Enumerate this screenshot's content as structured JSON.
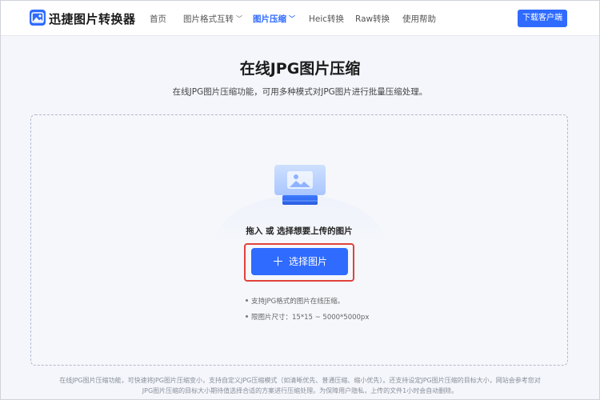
{
  "header": {
    "brand": "迅捷图片转换器",
    "nav": [
      {
        "label": "首页"
      },
      {
        "label": "图片格式互转"
      },
      {
        "label": "图片压缩"
      },
      {
        "label": "Heic转换"
      },
      {
        "label": "Raw转换"
      },
      {
        "label": "使用帮助"
      }
    ],
    "download_label": "下载客户端",
    "accent_color": "#2f6bff"
  },
  "main": {
    "title": "在线JPG图片压缩",
    "subtitle": "在线JPG图片压缩功能，可用多种模式对JPG图片进行批量压缩处理。",
    "upload": {
      "drop_text": "拖入 或 选择想要上传的图片",
      "select_label": "选择图片",
      "tips": [
        "支持JPG格式的图片在线压缩。",
        "限图片尺寸：15*15 ~ 5000*5000px"
      ]
    }
  },
  "footer": {
    "line1": "在线JPG图片压缩功能，可快速将JPG图片压缩变小，支持自定义JPG压缩模式（如清晰优先、普通压缩、缩小优先）。还支持设定JPG图片压缩的目标大小，网站会参考您对",
    "line2": "JPG图片压缩的目标大小期待值选择合适的方案进行压缩处理。为保障用户隐私，上传的文件1小时会自动删除。"
  }
}
